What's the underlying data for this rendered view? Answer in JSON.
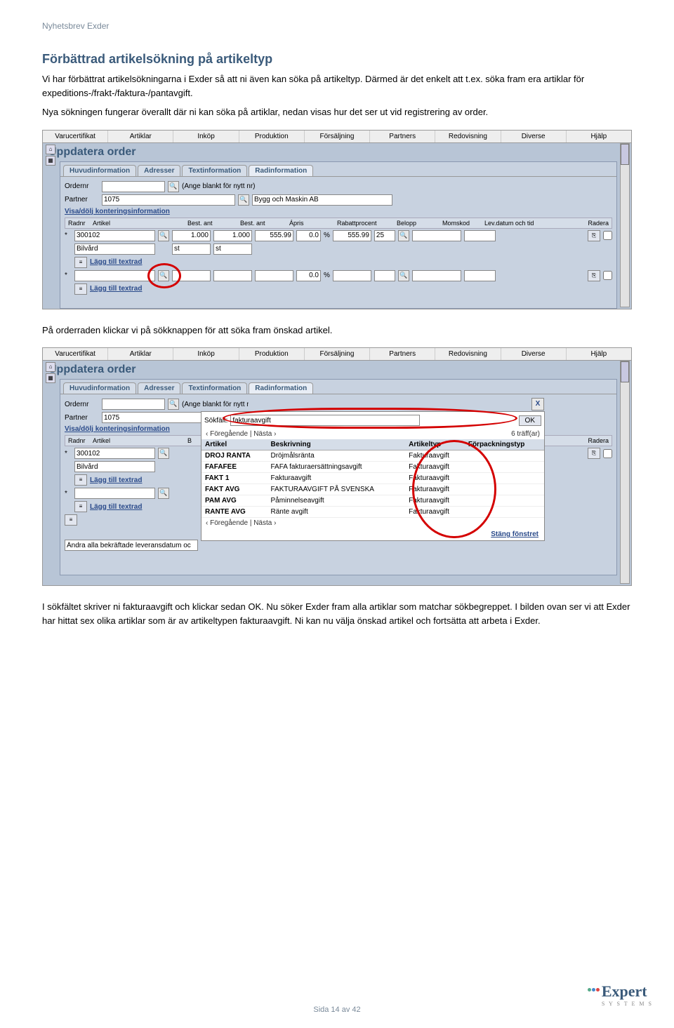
{
  "doc_header": "Nyhetsbrev Exder",
  "heading": "Förbättrad artikelsökning på artikeltyp",
  "para1": "Vi har förbättrat artikelsökningarna i Exder så att ni även kan söka på artikeltyp. Därmed är det enkelt att t.ex. söka fram era artiklar för expeditions-/frakt-/faktura-/pantavgift.",
  "para2": "Nya sökningen fungerar överallt där ni kan söka på artiklar, nedan visas hur det ser ut vid registrering av order.",
  "para3": "På orderraden klickar vi på sökknappen för att söka fram önskad artikel.",
  "para4": "I sökfältet skriver ni fakturaavgift och klickar sedan OK. Nu söker Exder fram alla artiklar som matchar sökbegreppet. I bilden ovan ser vi att Exder har hittat sex olika artiklar som är av artikeltypen fakturaavgift. Ni kan nu välja önskad artikel och fortsätta att arbeta i Exder.",
  "menu": [
    "Varucertifikat",
    "Artiklar",
    "Inköp",
    "Produktion",
    "Försäljning",
    "Partners",
    "Redovisning",
    "Diverse",
    "Hjälp"
  ],
  "app_title": "Uppdatera order",
  "tabs": [
    "Huvudinformation",
    "Adresser",
    "Textinformation",
    "Radinformation"
  ],
  "labels": {
    "ordernr": "Ordernr",
    "partner": "Partner",
    "blank_hint": "(Ange blankt för nytt nr)",
    "visa_dolj": "Visa/dölj konteringsinformation",
    "lagg_textrad": "Lägg till textrad",
    "andra_lev": "Ändra alla bekräftade leveransdatum oc",
    "sokfalt": "Sökfält:",
    "ok": "OK",
    "fg_nasta": "‹ Föregående | Nästa ›",
    "traff": "6 träff(ar)",
    "stang": "Stäng fönstret"
  },
  "form": {
    "partner_val": "1075",
    "partner_name": "Bygg och Maskin AB",
    "article_val": "300102",
    "article_name": "Bilvård",
    "best_ant": "1.000",
    "unit": "st",
    "apris": "555.99",
    "rabatt": "0.0",
    "belopp": "555.99",
    "momskod": "25",
    "rabatt2": "0.0",
    "percent": "%"
  },
  "grid_headers": {
    "radnr": "Radnr",
    "artikel": "Artikel",
    "best_ant1": "Best. ant",
    "best_ant2": "Best. ant",
    "apris": "Ápris",
    "rabatt": "Rabattprocent",
    "belopp": "Belopp",
    "momskod": "Momskod",
    "lev": "Lev.datum och tid",
    "radera": "Radera"
  },
  "popup": {
    "search_val": "fakturaavgift",
    "headers": [
      "Artikel",
      "Beskrivning",
      "Artikeltyp",
      "Förpackningstyp"
    ],
    "rows": [
      [
        "DROJ RANTA",
        "Dröjmålsränta",
        "Fakturaavgift",
        ""
      ],
      [
        "FAFAFEE",
        "FAFA fakturaersättningsavgift",
        "Fakturaavgift",
        ""
      ],
      [
        "FAKT 1",
        "Fakturaavgift",
        "Fakturaavgift",
        ""
      ],
      [
        "FAKT AVG",
        "FAKTURAAVGIFT PÅ SVENSKA",
        "Fakturaavgift",
        ""
      ],
      [
        "PAM AVG",
        "Påminnelseavgift",
        "Fakturaavgift",
        ""
      ],
      [
        "RANTE AVG",
        "Ränte avgift",
        "Fakturaavgift",
        ""
      ]
    ]
  },
  "footer": {
    "page": "Sida 14 av 42"
  }
}
